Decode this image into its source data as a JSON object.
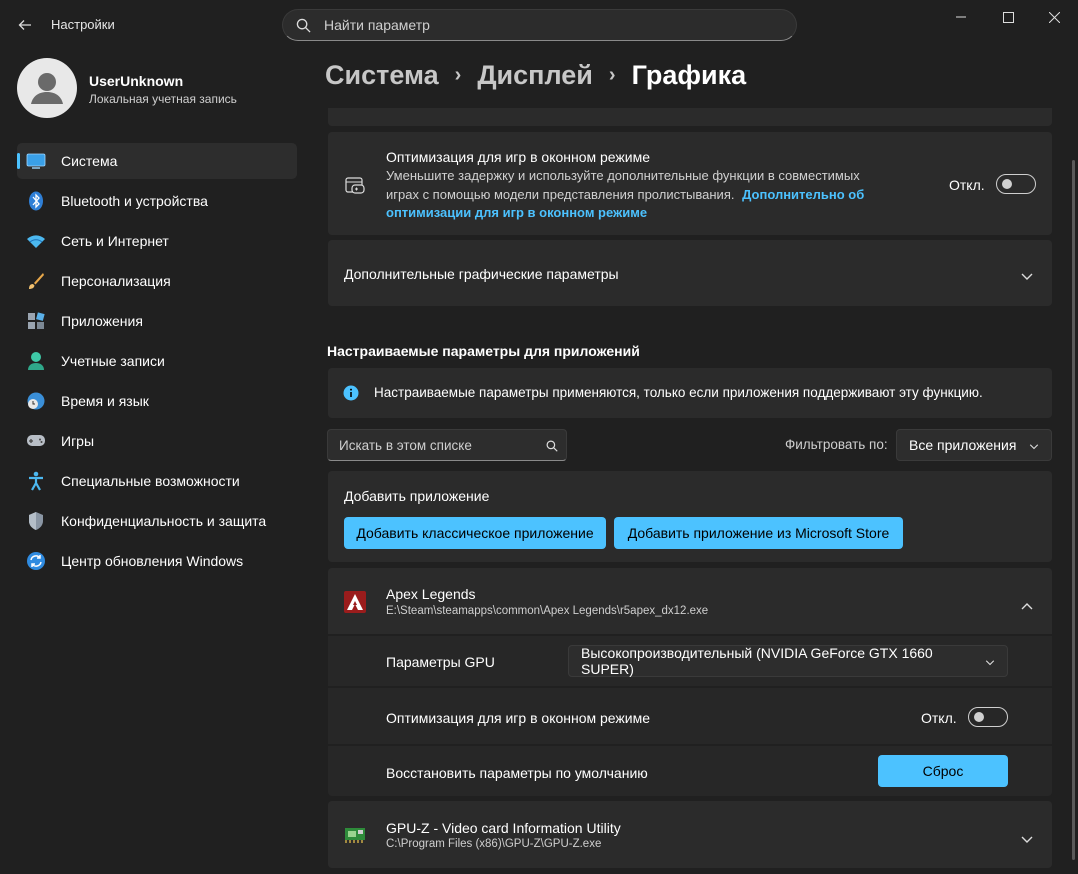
{
  "window": {
    "app_title": "Настройки",
    "search_placeholder": "Найти параметр"
  },
  "profile": {
    "name": "UserUnknown",
    "account_type": "Локальная учетная запись"
  },
  "sidebar": {
    "items": [
      {
        "label": "Система",
        "icon": "system-icon",
        "active": true
      },
      {
        "label": "Bluetooth и устройства",
        "icon": "bluetooth-icon"
      },
      {
        "label": "Сеть и Интернет",
        "icon": "wifi-icon"
      },
      {
        "label": "Персонализация",
        "icon": "brush-icon"
      },
      {
        "label": "Приложения",
        "icon": "apps-icon"
      },
      {
        "label": "Учетные записи",
        "icon": "account-icon"
      },
      {
        "label": "Время и язык",
        "icon": "time-language-icon"
      },
      {
        "label": "Игры",
        "icon": "gamepad-icon"
      },
      {
        "label": "Специальные возможности",
        "icon": "accessibility-icon"
      },
      {
        "label": "Конфиденциальность и защита",
        "icon": "shield-icon"
      },
      {
        "label": "Центр обновления Windows",
        "icon": "update-icon"
      }
    ]
  },
  "breadcrumb": {
    "level1": "Система",
    "level2": "Дисплей",
    "current": "Графика"
  },
  "windowed_opt": {
    "title": "Оптимизация для игр в оконном режиме",
    "desc_line1": "Уменьшите задержку и используйте дополнительные функции в совместимых",
    "desc_line2": "играх с помощью модели представления пролистывания.",
    "link_line1": "Дополнительно об",
    "link_line2": "оптимизации для игр в оконном режиме",
    "state_label": "Откл."
  },
  "advanced": {
    "label": "Дополнительные графические параметры"
  },
  "custom_section": {
    "heading": "Настраиваемые параметры для приложений",
    "info_text": "Настраиваемые параметры применяются, только если приложения поддерживают эту функцию.",
    "search_placeholder": "Искать в этом списке",
    "filter_label": "Фильтровать по:",
    "filter_value": "Все приложения"
  },
  "add_app": {
    "label": "Добавить приложение",
    "classic_button": "Добавить классическое приложение",
    "store_button": "Добавить приложение из Microsoft Store"
  },
  "apps": [
    {
      "name": "Apex Legends",
      "path": "E:\\Steam\\steamapps\\common\\Apex Legends\\r5apex_dx12.exe",
      "gpu_label": "Параметры GPU",
      "gpu_value": "Высокопроизводительный (NVIDIA GeForce GTX 1660 SUPER)",
      "windowed_label": "Оптимизация для игр в оконном режиме",
      "windowed_state": "Откл.",
      "reset_label": "Восстановить параметры по умолчанию",
      "reset_button": "Сброс"
    },
    {
      "name": "GPU-Z - Video card Information Utility",
      "path": "C:\\Program Files (x86)\\GPU-Z\\GPU-Z.exe"
    }
  ],
  "colors": {
    "accent": "#4cc2ff",
    "background": "#202020",
    "card": "#2b2b2b"
  }
}
